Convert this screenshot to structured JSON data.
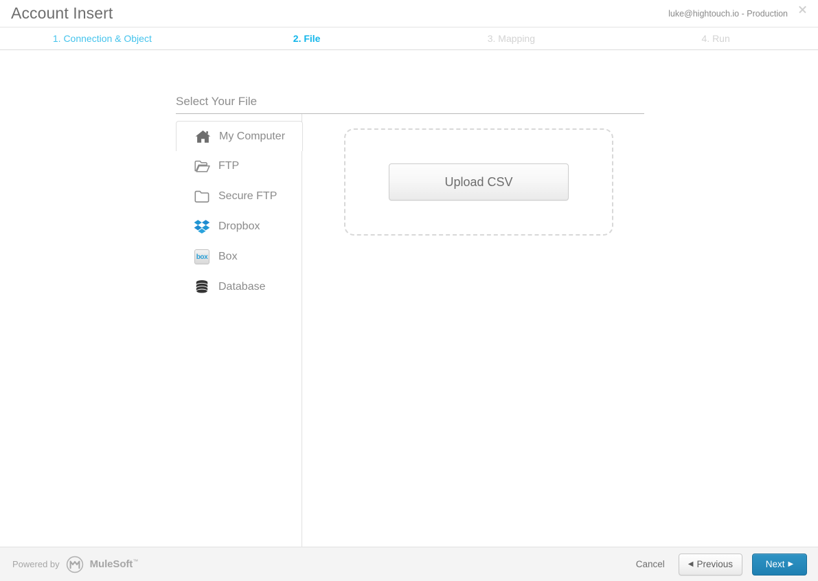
{
  "window": {
    "title": "Account Insert",
    "account": "luke@hightouch.io - Production",
    "close_icon": "close-icon"
  },
  "steps": [
    {
      "label": "1. Connection & Object",
      "state": "done"
    },
    {
      "label": "2. File",
      "state": "active"
    },
    {
      "label": "3. Mapping",
      "state": "todo"
    },
    {
      "label": "4. Run",
      "state": "todo"
    }
  ],
  "main": {
    "section_title": "Select Your File",
    "sources": [
      {
        "label": "My Computer",
        "icon": "home-icon",
        "selected": true
      },
      {
        "label": "FTP",
        "icon": "folder-open-icon",
        "selected": false
      },
      {
        "label": "Secure FTP",
        "icon": "folder-icon",
        "selected": false
      },
      {
        "label": "Dropbox",
        "icon": "dropbox-icon",
        "selected": false
      },
      {
        "label": "Box",
        "icon": "box-icon",
        "selected": false
      },
      {
        "label": "Database",
        "icon": "database-icon",
        "selected": false
      }
    ],
    "dropzone": {
      "upload_label": "Upload CSV"
    }
  },
  "footer": {
    "powered_by": "Powered by",
    "brand": "MuleSoft",
    "trademark": "™",
    "cancel_label": "Cancel",
    "previous_label": "Previous",
    "next_label": "Next",
    "prev_arrow": "◀",
    "next_arrow": "▶"
  },
  "colors": {
    "accent_active": "#13b6ea",
    "accent_done": "#44c3ec",
    "step_todo": "#d3d3d3",
    "next_button": "#1f80b2",
    "dropbox_blue": "#2196d3",
    "box_blue": "#2a9fd6"
  }
}
